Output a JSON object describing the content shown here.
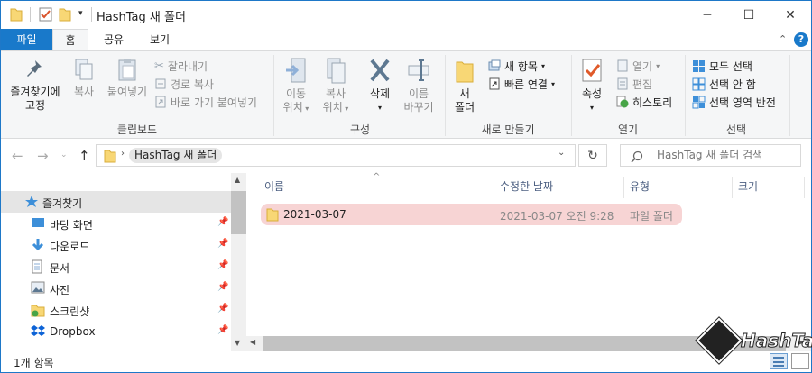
{
  "window": {
    "title": "HashTag 새 폴더",
    "controls": {
      "minimize": "─",
      "maximize": "☐",
      "close": "✕"
    }
  },
  "ribbon_tabs": [
    "파일",
    "홈",
    "공유",
    "보기"
  ],
  "ribbon": {
    "clipboard": {
      "label": "클립보드",
      "pin": "즐겨찾기에\n고정",
      "copy": "복사",
      "paste": "붙여넣기",
      "cut": "잘라내기",
      "copy_path": "경로 복사",
      "paste_shortcut": "바로 가기 붙여넣기"
    },
    "organize": {
      "label": "구성",
      "move_to": "이동\n위치",
      "copy_to": "복사\n위치",
      "delete": "삭제",
      "rename": "이름\n바꾸기"
    },
    "new": {
      "label": "새로 만들기",
      "new_folder": "새\n폴더",
      "new_item": "새 항목",
      "easy_access": "빠른 연결"
    },
    "open": {
      "label": "열기",
      "properties": "속성",
      "open": "열기",
      "edit": "편집",
      "history": "히스토리"
    },
    "select": {
      "label": "선택",
      "select_all": "모두 선택",
      "select_none": "선택 안 함",
      "invert": "선택 영역 반전"
    }
  },
  "address": {
    "crumb": "HashTag 새 폴더",
    "search_placeholder": "HashTag 새 폴더 검색"
  },
  "nav_pane": {
    "items": [
      {
        "label": "즐겨찾기",
        "icon": "star-icon",
        "pinned": false,
        "selected": true
      },
      {
        "label": "바탕 화면",
        "icon": "desktop-icon",
        "pinned": true
      },
      {
        "label": "다운로드",
        "icon": "download-icon",
        "pinned": true
      },
      {
        "label": "문서",
        "icon": "document-icon",
        "pinned": true
      },
      {
        "label": "사진",
        "icon": "pictures-icon",
        "pinned": true
      },
      {
        "label": "스크린샷",
        "icon": "screenshot-folder-icon",
        "pinned": true
      },
      {
        "label": "Dropbox",
        "icon": "dropbox-icon",
        "pinned": true
      }
    ]
  },
  "file_list": {
    "columns": [
      "이름",
      "수정한 날짜",
      "유형",
      "크기"
    ],
    "rows": [
      {
        "name": "2021-03-07",
        "modified": "2021-03-07 오전 9:28",
        "type": "파일 폴더",
        "size": ""
      }
    ]
  },
  "status": {
    "count": "1개 항목"
  },
  "watermark": "HashTag",
  "colors": {
    "accent": "#1979ca",
    "selection_row": "#f7d4d4"
  }
}
